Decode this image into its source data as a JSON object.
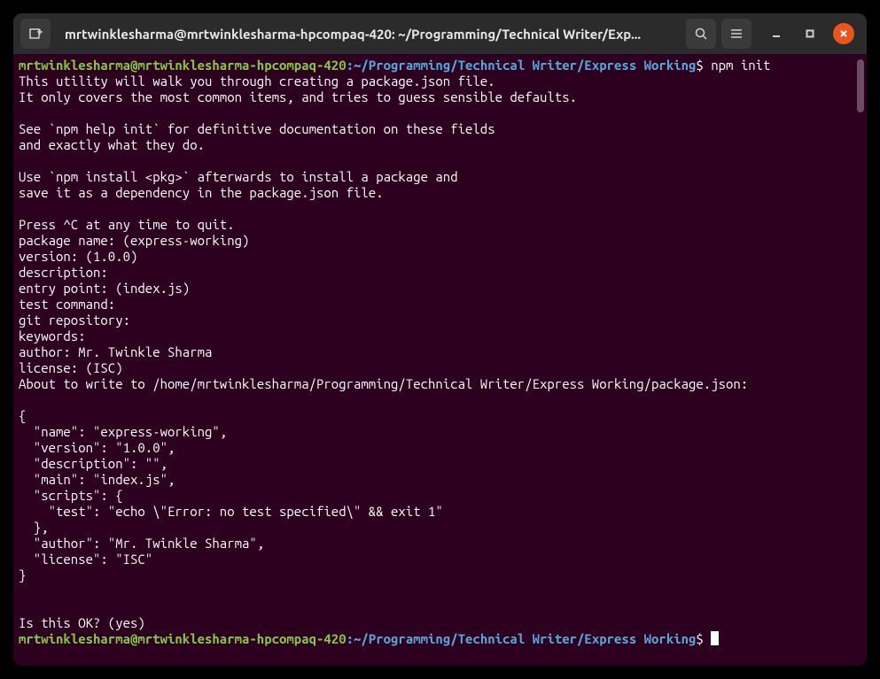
{
  "titlebar": {
    "title": "mrtwinklesharma@mrtwinklesharma-hpcompaq-420: ~/Programming/Technical Writer/Exp..."
  },
  "prompt1": {
    "user": "mrtwinklesharma@mrtwinklesharma-hpcompaq-420",
    "colon": ":",
    "path": "~/Programming/Technical Writer/Express Working",
    "dollar": "$",
    "command": " npm init"
  },
  "intro": {
    "l1": "This utility will walk you through creating a package.json file.",
    "l2": "It only covers the most common items, and tries to guess sensible defaults.",
    "l3": "See `npm help init` for definitive documentation on these fields",
    "l4": "and exactly what they do.",
    "l5": "Use `npm install <pkg>` afterwards to install a package and",
    "l6": "save it as a dependency in the package.json file.",
    "l7": "Press ^C at any time to quit."
  },
  "prompts": {
    "pkgname": "package name: (express-working) ",
    "version": "version: (1.0.0) ",
    "description": "description: ",
    "entry": "entry point: (index.js) ",
    "test": "test command: ",
    "git": "git repository: ",
    "keywords": "keywords: ",
    "author": "author: Mr. Twinkle Sharma",
    "license": "license: (ISC) ",
    "about": "About to write to /home/mrtwinklesharma/Programming/Technical Writer/Express Working/package.json:"
  },
  "json": {
    "l1": "{",
    "l2": "  \"name\": \"express-working\",",
    "l3": "  \"version\": \"1.0.0\",",
    "l4": "  \"description\": \"\",",
    "l5": "  \"main\": \"index.js\",",
    "l6": "  \"scripts\": {",
    "l7": "    \"test\": \"echo \\\"Error: no test specified\\\" && exit 1\"",
    "l8": "  },",
    "l9": "  \"author\": \"Mr. Twinkle Sharma\",",
    "l10": "  \"license\": \"ISC\"",
    "l11": "}"
  },
  "confirm": "Is this OK? (yes) ",
  "prompt2": {
    "user": "mrtwinklesharma@mrtwinklesharma-hpcompaq-420",
    "colon": ":",
    "path": "~/Programming/Technical Writer/Express Working",
    "dollar": "$"
  }
}
